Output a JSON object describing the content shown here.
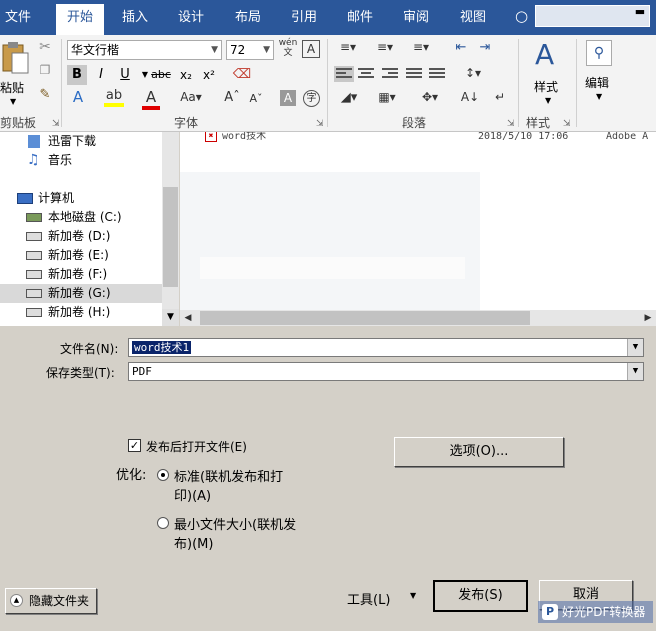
{
  "ribbon": {
    "tabs": [
      "文件",
      "开始",
      "插入",
      "设计",
      "布局",
      "引用",
      "邮件",
      "审阅",
      "视图"
    ],
    "active_tab": "开始",
    "groups": {
      "clipboard": {
        "paste_label": "粘贴",
        "label": "剪贴板"
      },
      "font": {
        "font_name": "华文行楷",
        "font_size": "72",
        "label": "字体"
      },
      "paragraph": {
        "label": "段落"
      },
      "styles": {
        "button_label": "样式",
        "label": "样式"
      },
      "editing": {
        "button_label": "编辑"
      }
    }
  },
  "tree": {
    "items": [
      {
        "label": "迅雷下载"
      },
      {
        "label": "音乐"
      },
      {
        "label": "计算机"
      },
      {
        "label": "本地磁盘 (C:)"
      },
      {
        "label": "新加卷 (D:)"
      },
      {
        "label": "新加卷 (E:)"
      },
      {
        "label": "新加卷 (F:)"
      },
      {
        "label": "新加卷 (G:)"
      },
      {
        "label": "新加卷 (H:)"
      }
    ]
  },
  "file_list": {
    "rows": [
      {
        "name": "word技术",
        "date": "2018/5/10 17:06",
        "type": "Adobe A"
      }
    ]
  },
  "form": {
    "filename_label": "文件名(N):",
    "filename_value": "word技术1",
    "filetype_label": "保存类型(T):",
    "filetype_value": "PDF",
    "open_after_label": "发布后打开文件(E)",
    "optimize_label": "优化:",
    "opt_standard_label_1": "标准(联机发布和打",
    "opt_standard_label_2": "印)(A)",
    "opt_min_label_1": "最小文件大小(联机发",
    "opt_min_label_2": "布)(M)",
    "options_button": "选项(O)...",
    "hide_folders_button": "隐藏文件夹",
    "tools_label": "工具(L)",
    "publish_button": "发布(S)",
    "cancel_button": "取消"
  },
  "watermark": {
    "text": "好光PDF转换器"
  },
  "colors": {
    "accent": "#2b579a",
    "dialog_bg": "#d4d0c8",
    "selection": "#0a246a"
  }
}
